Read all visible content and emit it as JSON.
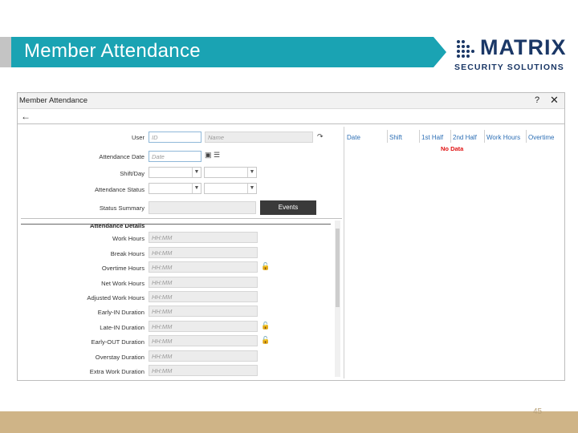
{
  "slide": {
    "title": "Member Attendance",
    "page_number": "45",
    "accent_color": "#1aa3b3",
    "footer_color": "#cfb487"
  },
  "logo": {
    "word": "MATRIX",
    "tagline": "SECURITY SOLUTIONS",
    "color": "#1a3766"
  },
  "window": {
    "title": "Member Attendance",
    "help_label": "?",
    "close_label": "✕",
    "back_icon": "back-arrow-icon"
  },
  "form": {
    "user": {
      "label": "User",
      "id_placeholder": "ID",
      "name_placeholder": "Name"
    },
    "attendance_date": {
      "label": "Attendance Date",
      "placeholder": "Date"
    },
    "shift_day": {
      "label": "Shift/Day"
    },
    "attendance_status": {
      "label": "Attendance Status"
    },
    "status_summary": {
      "label": "Status Summary"
    },
    "events_button": "Events"
  },
  "details": {
    "heading": "Attendance Details",
    "rows": [
      {
        "label": "Work Hours",
        "placeholder": "HH:MM",
        "lock": false
      },
      {
        "label": "Break Hours",
        "placeholder": "HH:MM",
        "lock": false
      },
      {
        "label": "Overtime Hours",
        "placeholder": "HH:MM",
        "lock": true
      },
      {
        "label": "Net Work Hours",
        "placeholder": "HH:MM",
        "lock": false
      },
      {
        "label": "Adjusted Work Hours",
        "placeholder": "HH:MM",
        "lock": false
      },
      {
        "label": "Early-IN Duration",
        "placeholder": "HH:MM",
        "lock": false
      },
      {
        "label": "Late-IN Duration",
        "placeholder": "HH:MM",
        "lock": true
      },
      {
        "label": "Early-OUT Duration",
        "placeholder": "HH:MM",
        "lock": true
      },
      {
        "label": "Overstay Duration",
        "placeholder": "HH:MM",
        "lock": false
      },
      {
        "label": "Extra Work Duration",
        "placeholder": "HH:MM",
        "lock": false
      }
    ]
  },
  "table": {
    "columns": [
      "Date",
      "Shift",
      "1st Half",
      "2nd Half",
      "Work Hours",
      "Overtime"
    ],
    "empty_text": "No Data"
  }
}
